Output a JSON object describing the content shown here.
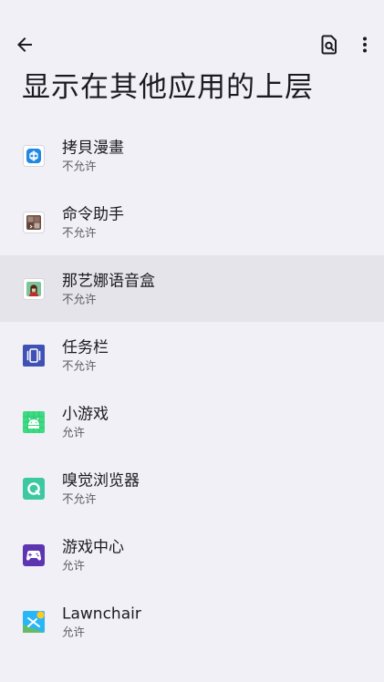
{
  "toolbar": {
    "back_icon": "arrow-back-icon",
    "search_icon": "document-search-icon",
    "more_icon": "more-vert-icon"
  },
  "page": {
    "title": "显示在其他应用的上层"
  },
  "apps": [
    {
      "name": "拷貝漫畫",
      "status": "不允许",
      "icon": "copymanga-app-icon",
      "pressed": false
    },
    {
      "name": "命令助手",
      "status": "不允许",
      "icon": "command-helper-app-icon",
      "pressed": false
    },
    {
      "name": "那艺娜语音盒",
      "status": "不允许",
      "icon": "voicebox-app-icon",
      "pressed": true
    },
    {
      "name": "任务栏",
      "status": "不允许",
      "icon": "taskbar-app-icon",
      "pressed": false
    },
    {
      "name": "小游戏",
      "status": "允许",
      "icon": "android-app-icon",
      "pressed": false
    },
    {
      "name": "嗅觉浏览器",
      "status": "不允许",
      "icon": "xiu-browser-app-icon",
      "pressed": false
    },
    {
      "name": "游戏中心",
      "status": "允许",
      "icon": "game-center-app-icon",
      "pressed": false
    },
    {
      "name": "Lawnchair",
      "status": "允许",
      "icon": "lawnchair-app-icon",
      "pressed": false
    }
  ],
  "colors": {
    "background": "#f1f0f6",
    "pressed_row": "#e5e4eb",
    "text_primary": "#1b1b1f",
    "text_secondary": "#5b5b63"
  }
}
